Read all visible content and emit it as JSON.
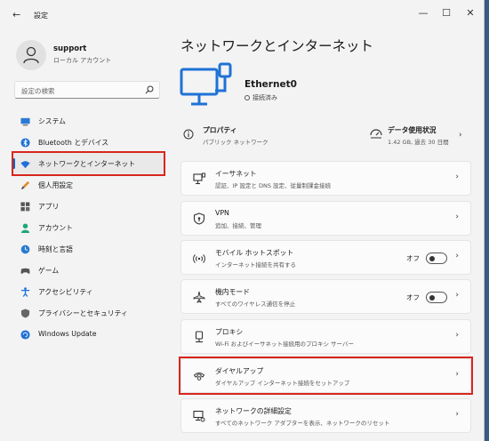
{
  "window": {
    "title": "設定",
    "back": "←",
    "minimize": "—",
    "maximize": "☐",
    "close": "✕"
  },
  "user": {
    "name": "support",
    "account_type": "ローカル アカウント"
  },
  "search": {
    "placeholder": "設定の検索"
  },
  "nav": [
    {
      "label": "システム"
    },
    {
      "label": "Bluetooth とデバイス"
    },
    {
      "label": "ネットワークとインターネット"
    },
    {
      "label": "個人用設定"
    },
    {
      "label": "アプリ"
    },
    {
      "label": "アカウント"
    },
    {
      "label": "時刻と言語"
    },
    {
      "label": "ゲーム"
    },
    {
      "label": "アクセシビリティ"
    },
    {
      "label": "プライバシーとセキュリティ"
    },
    {
      "label": "Windows Update"
    }
  ],
  "main": {
    "title": "ネットワークとインターネット",
    "adapter_name": "Ethernet0",
    "adapter_status": "接続済み",
    "properties": {
      "title": "プロパティ",
      "subtitle": "パブリック ネットワーク"
    },
    "data_usage": {
      "title": "データ使用状況",
      "subtitle": "1.42 GB, 過去 30 日間"
    },
    "cards": [
      {
        "title": "イーサネット",
        "subtitle": "認証、IP 設定と DNS 設定、従量制課金接続"
      },
      {
        "title": "VPN",
        "subtitle": "追加、接続、管理"
      },
      {
        "title": "モバイル ホットスポット",
        "subtitle": "インターネット接続を共有する",
        "toggle": "オフ"
      },
      {
        "title": "機内モード",
        "subtitle": "すべてのワイヤレス通信を停止",
        "toggle": "オフ"
      },
      {
        "title": "プロキシ",
        "subtitle": "Wi-Fi およびイーサネット接続用のプロキシ サーバー"
      },
      {
        "title": "ダイヤルアップ",
        "subtitle": "ダイヤルアップ インターネット接続をセットアップ"
      },
      {
        "title": "ネットワークの詳細設定",
        "subtitle": "すべてのネットワーク アダプターを表示、ネットワークのリセット"
      }
    ]
  },
  "colors": {
    "accent": "#0067c0",
    "highlight": "#d9251d"
  }
}
